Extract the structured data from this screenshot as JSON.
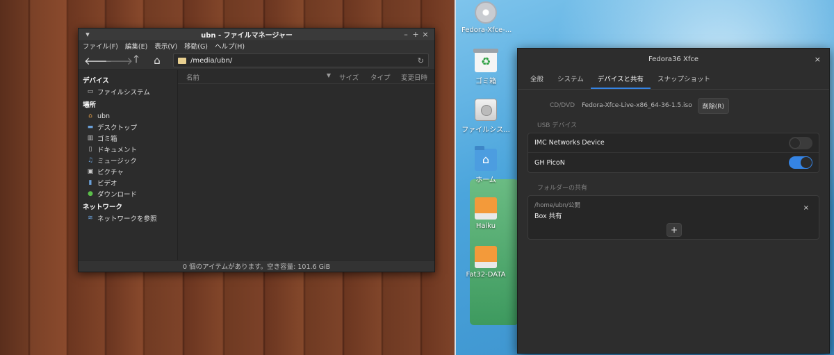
{
  "desktop_icons": [
    {
      "label": "Fedora-Xfce-...",
      "icon": "disc-icon"
    },
    {
      "label": "ゴミ箱",
      "icon": "trash-icon"
    },
    {
      "label": "ファイルシス...",
      "icon": "harddisk-icon"
    },
    {
      "label": "ホーム",
      "icon": "home-folder-icon"
    },
    {
      "label": "Haiku",
      "icon": "drive-icon"
    },
    {
      "label": "Fat32-DATA",
      "icon": "drive-icon"
    }
  ],
  "file_manager": {
    "title": "ubn - ファイルマネージャー",
    "window_buttons": {
      "menu": "▾",
      "minimize": "–",
      "maximize": "+",
      "close": "×"
    },
    "menu": [
      "ファイル(F)",
      "編集(E)",
      "表示(V)",
      "移動(G)",
      "ヘルプ(H)"
    ],
    "path": "/media/ubn/",
    "sidebar": {
      "devices_header": "デバイス",
      "devices": [
        {
          "label": "ファイルシステム",
          "icon": "harddisk-icon"
        }
      ],
      "places_header": "場所",
      "places": [
        {
          "label": "ubn",
          "icon": "home-icon"
        },
        {
          "label": "デスクトップ",
          "icon": "desktop-icon"
        },
        {
          "label": "ゴミ箱",
          "icon": "trash-icon"
        },
        {
          "label": "ドキュメント",
          "icon": "document-icon"
        },
        {
          "label": "ミュージック",
          "icon": "music-icon"
        },
        {
          "label": "ピクチャ",
          "icon": "picture-icon"
        },
        {
          "label": "ビデオ",
          "icon": "video-icon"
        },
        {
          "label": "ダウンロード",
          "icon": "download-icon"
        }
      ],
      "network_header": "ネットワーク",
      "network": [
        {
          "label": "ネットワークを参照",
          "icon": "wifi-icon"
        }
      ]
    },
    "columns": [
      "名前",
      "サイズ",
      "タイプ",
      "変更日時"
    ],
    "status": "0 個のアイテムがあります。空き容量: 101.6 GiB"
  },
  "dialog": {
    "title": "Fedora36 Xfce",
    "tabs": [
      "全般",
      "システム",
      "デバイスと共有",
      "スナップショット"
    ],
    "active_tab": "デバイスと共有",
    "cd_label": "CD/DVD",
    "cd_value": "Fedora-Xfce-Live-x86_64-36-1.5.iso",
    "cd_remove": "削除(R)",
    "usb_header": "USB デバイス",
    "usb_devices": [
      {
        "name": "IMC Networks Device",
        "enabled": false
      },
      {
        "name": "GH PicoN",
        "enabled": true
      }
    ],
    "share_header": "フォルダーの共有",
    "share_path": "/home/ubn/公開",
    "share_name": "Box 共有",
    "share_remove": "×",
    "add": "+",
    "close": "×"
  },
  "colors": {
    "accent": "#3584e4"
  }
}
